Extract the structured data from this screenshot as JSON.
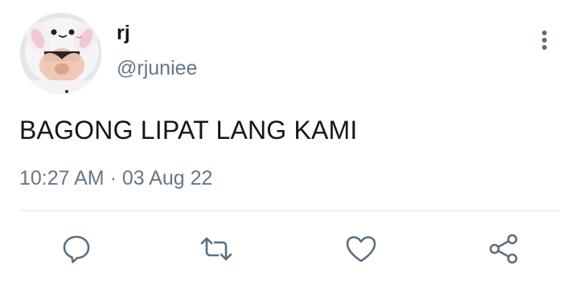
{
  "tweet": {
    "display_name": "rj",
    "handle": "@rjuniee",
    "text": "BAGONG LIPAT LANG KAMI",
    "timestamp": "10:27 AM · 03 Aug 22"
  },
  "actions": [
    "reply-icon",
    "retweet-icon",
    "like-icon",
    "share-icon"
  ],
  "colors": {
    "primary_text": "#14171a",
    "secondary_text": "#657786",
    "icon": "#5b6f7e",
    "divider": "#e1e8ed"
  }
}
